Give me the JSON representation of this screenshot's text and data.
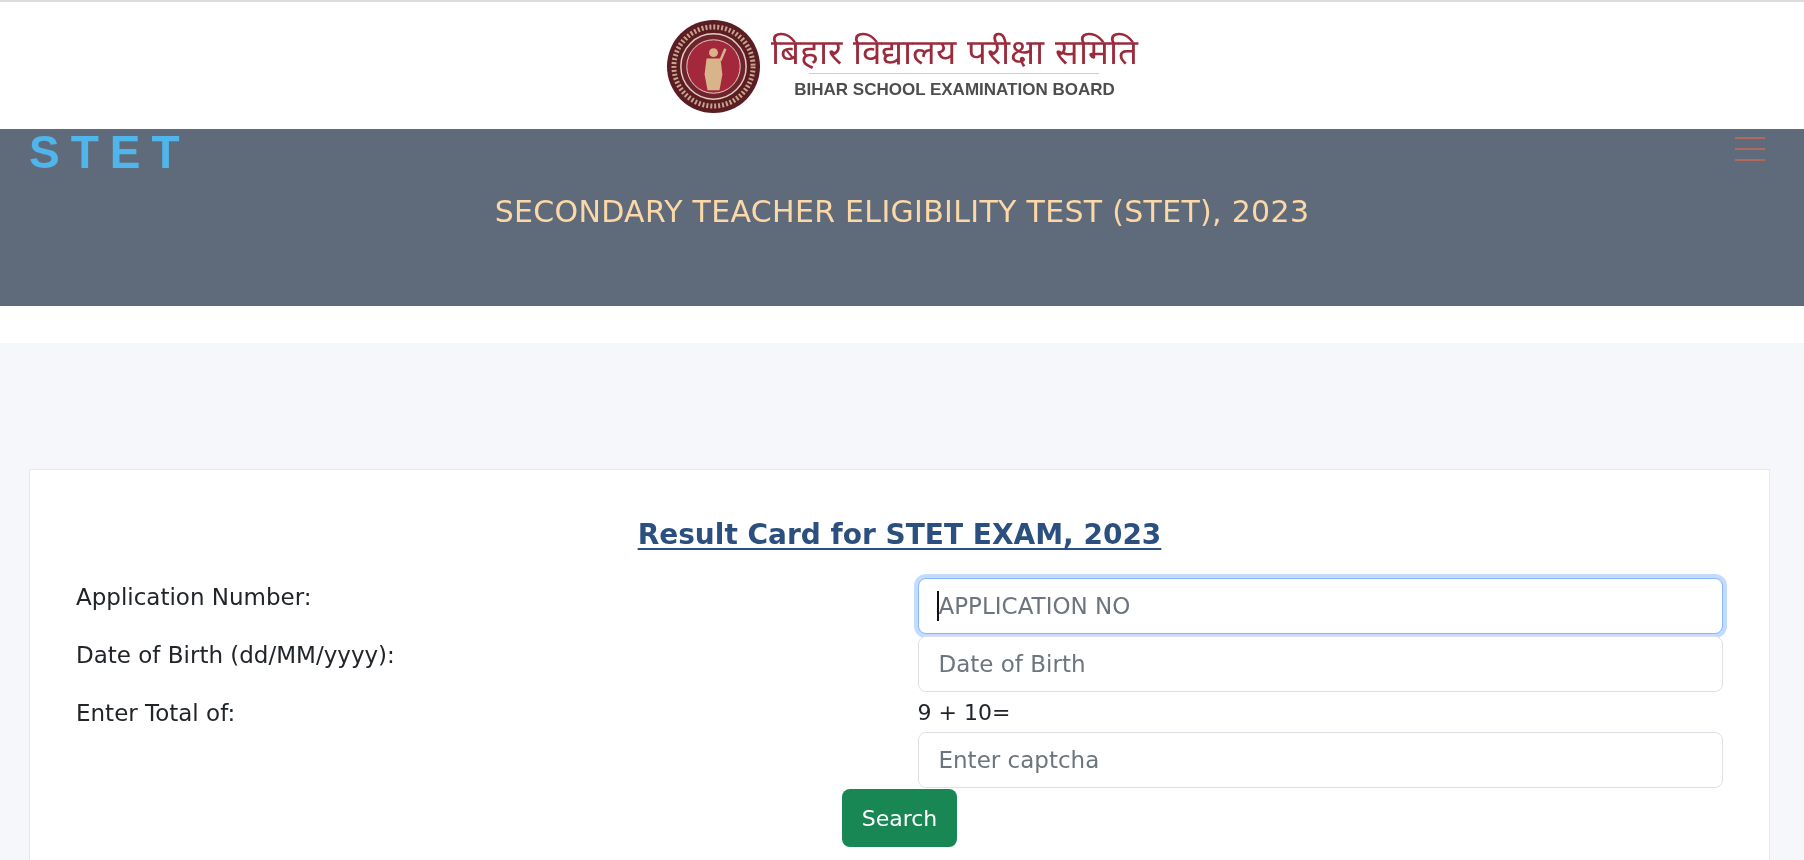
{
  "logo": {
    "hindi_name": "बिहार विद्यालय परीक्षा समिति",
    "english_name": "BIHAR SCHOOL EXAMINATION BOARD"
  },
  "header": {
    "brand": "STET",
    "title": "SECONDARY TEACHER ELIGIBILITY TEST (STET), 2023"
  },
  "form": {
    "heading": "Result Card for STET EXAM, 2023",
    "fields": [
      {
        "label": "Application Number:",
        "placeholder": "APPLICATION NO",
        "focused": true
      },
      {
        "label": "Date of Birth (dd/MM/yyyy):",
        "placeholder": "Date of Birth",
        "focused": false
      },
      {
        "label": "Enter Total of:",
        "prompt": "9 + 10=",
        "placeholder": "Enter captcha",
        "focused": false
      }
    ],
    "search_button": "Search"
  }
}
